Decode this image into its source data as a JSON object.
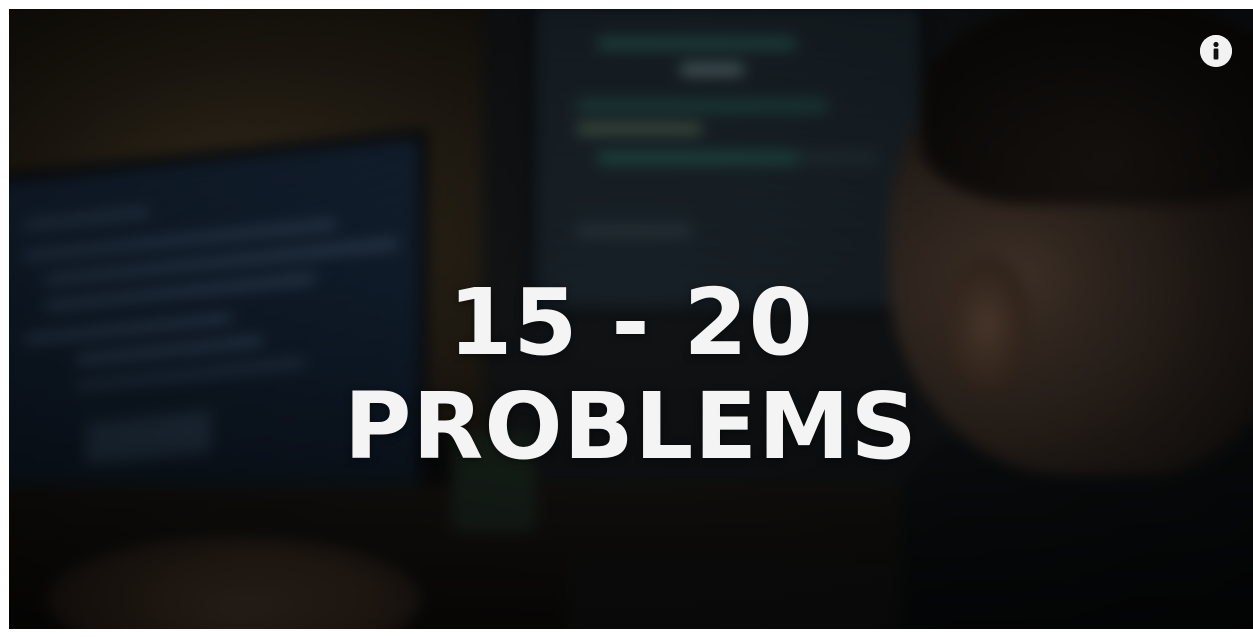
{
  "video": {
    "overlay_line1": "15 - 20",
    "overlay_line2": "PROBLEMS",
    "info_icon": "info-icon"
  }
}
